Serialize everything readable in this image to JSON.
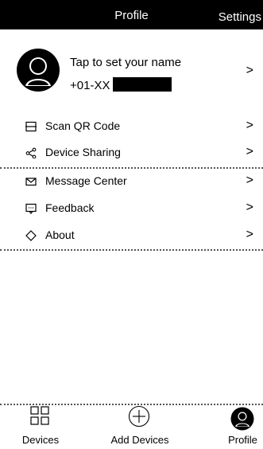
{
  "header": {
    "title": "Profile",
    "settings_label": "Settings"
  },
  "profile": {
    "name_prompt": "Tap to set your name",
    "phone_prefix": "+01-XX"
  },
  "menu": {
    "items": [
      {
        "label": "Scan QR Code",
        "icon": "qr-scan-icon"
      },
      {
        "label": "Device Sharing",
        "icon": "share-icon"
      },
      {
        "label": "Message Center",
        "icon": "envelope-icon"
      },
      {
        "label": "Feedback",
        "icon": "feedback-icon"
      },
      {
        "label": "About",
        "icon": "diamond-icon"
      }
    ],
    "chevron": ">"
  },
  "tabbar": {
    "tabs": [
      {
        "label": "Devices",
        "icon": "grid-icon"
      },
      {
        "label": "Add Devices",
        "icon": "plus-circle-icon"
      },
      {
        "label": "Profile",
        "icon": "user-avatar-icon"
      }
    ]
  }
}
